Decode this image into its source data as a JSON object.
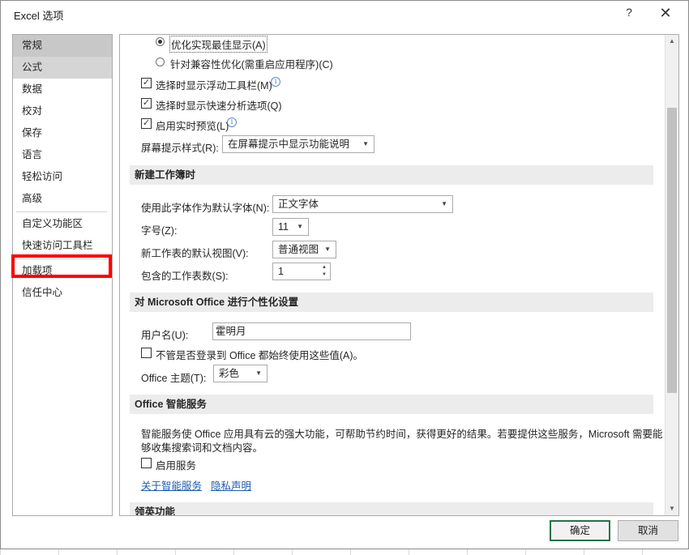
{
  "window": {
    "title": "Excel 选项",
    "help": "?",
    "close": "✕"
  },
  "nav": {
    "items": [
      {
        "label": "常规"
      },
      {
        "label": "公式"
      },
      {
        "label": "数据"
      },
      {
        "label": "校对"
      },
      {
        "label": "保存"
      },
      {
        "label": "语言"
      },
      {
        "label": "轻松访问"
      },
      {
        "label": "高级"
      },
      {
        "label": "自定义功能区"
      },
      {
        "label": "快速访问工具栏"
      },
      {
        "label": "加载项"
      },
      {
        "label": "信任中心"
      }
    ]
  },
  "ui": {
    "radio_best": "优化实现最佳显示(A)",
    "radio_compat": "针对兼容性优化(需重启应用程序)(C)",
    "chk_minitoolbar": "选择时显示浮动工具栏(M)",
    "chk_quickanalysis": "选择时显示快速分析选项(Q)",
    "chk_livepreview": "启用实时预览(L)",
    "screentip_label": "屏幕提示样式(R):",
    "screentip_value": "在屏幕提示中显示功能说明"
  },
  "new_workbook": {
    "header": "新建工作簿时",
    "font_label": "使用此字体作为默认字体(N):",
    "font_value": "正文字体",
    "size_label": "字号(Z):",
    "size_value": "11",
    "view_label": "新工作表的默认视图(V):",
    "view_value": "普通视图",
    "sheets_label": "包含的工作表数(S):",
    "sheets_value": "1"
  },
  "personalize": {
    "header": "对 Microsoft Office 进行个性化设置",
    "username_label": "用户名(U):",
    "username_value": "霍明月",
    "always_use_label": "不管是否登录到 Office 都始终使用这些值(A)。",
    "theme_label": "Office 主题(T):",
    "theme_value": "彩色"
  },
  "intelligent": {
    "header": "Office 智能服务",
    "desc_line1": "智能服务使 Office 应用具有云的强大功能，可帮助节约时间，获得更好的结果。若要提供这些服务，Microsoft 需要能",
    "desc_line2": "够收集搜索词和文档内容。",
    "enable_label": "启用服务",
    "about_link": "关于智能服务",
    "privacy_link": "隐私声明"
  },
  "linkedin": {
    "header": "领英功能"
  },
  "buttons": {
    "ok": "确定",
    "cancel": "取消"
  },
  "colors": {
    "accent": "#217346",
    "highlight": "#ff0000",
    "link": "#1f5db3"
  }
}
